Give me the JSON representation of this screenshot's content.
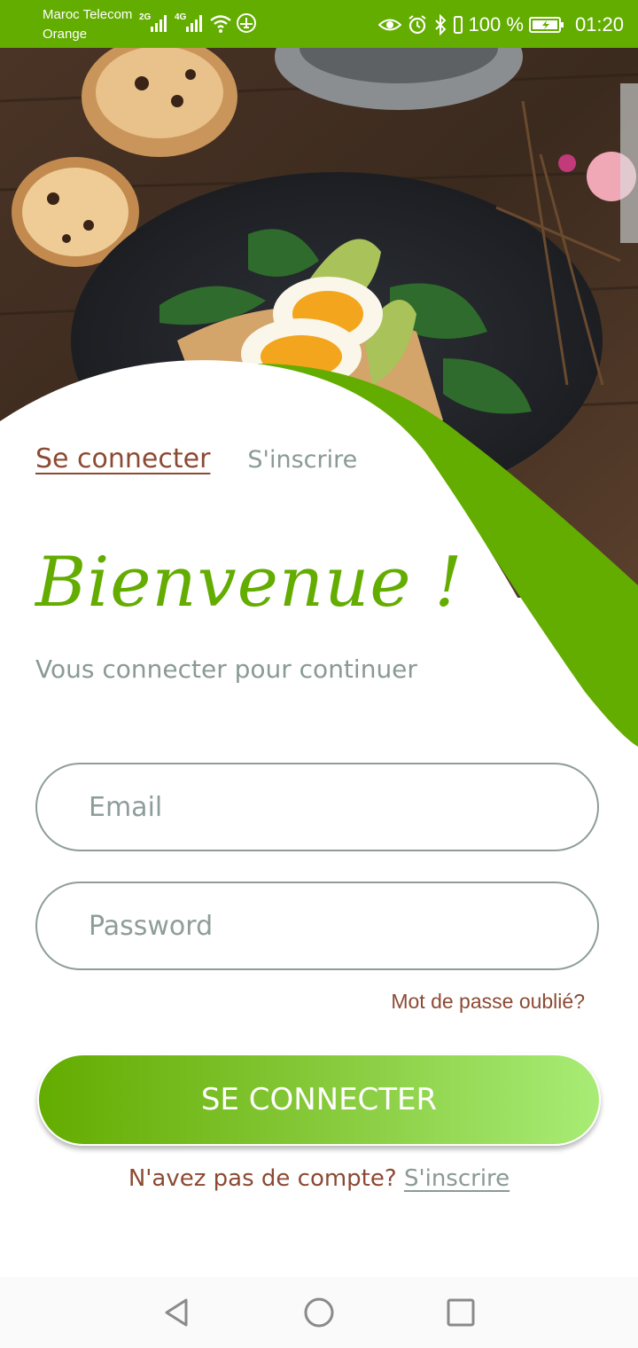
{
  "status_bar": {
    "carrier_primary": "Maroc Telecom",
    "carrier_secondary": "Orange",
    "network_primary": "2G",
    "network_secondary": "4G",
    "battery_percent": "100 %",
    "time": "01:20",
    "icons": [
      "signal-icon",
      "wifi-icon",
      "airplane-icon",
      "eye-icon",
      "alarm-icon",
      "bluetooth-icon",
      "battery-icon"
    ]
  },
  "tabs": {
    "login": "Se connecter",
    "signup": "S'inscrire"
  },
  "welcome": {
    "title": "Bienvenue !",
    "subtitle": "Vous connecter pour continuer"
  },
  "form": {
    "email_placeholder": "Email",
    "password_placeholder": "Password",
    "forgot_password": "Mot de passe oublié?",
    "submit_label": "SE CONNECTER"
  },
  "footer": {
    "no_account": "N'avez pas de compte?",
    "signup_link": "S'inscrire"
  },
  "colors": {
    "brand_green": "#63ac00",
    "accent_brown": "#8c4a33",
    "muted_gray": "#8a9a94",
    "button_gradient_end": "#a8ec76"
  },
  "nav_bar": {
    "icons": [
      "back-icon",
      "home-icon",
      "recents-icon"
    ]
  }
}
